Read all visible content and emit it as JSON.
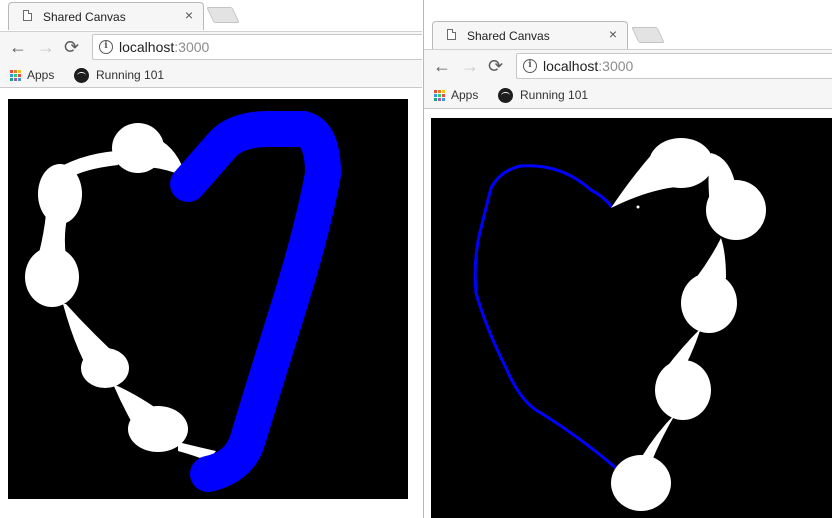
{
  "windows": [
    {
      "tab": {
        "title": "Shared Canvas",
        "close": "×"
      },
      "url": {
        "host": "localhost",
        "port": ":3000"
      },
      "bookmarks": {
        "apps": "Apps",
        "running": "Running 101"
      }
    },
    {
      "tab": {
        "title": "Shared Canvas",
        "close": "×"
      },
      "url": {
        "host": "localhost",
        "port": ":3000"
      },
      "bookmarks": {
        "apps": "Apps",
        "running": "Running 101"
      }
    }
  ],
  "colors": {
    "canvas_bg": "#000000",
    "stroke_white": "#ffffff",
    "stroke_blue": "#0000ff"
  },
  "icons": [
    "page-icon",
    "close-icon",
    "back-arrow-icon",
    "forward-arrow-icon",
    "reload-icon",
    "info-icon",
    "apps-grid-icon",
    "spotify-icon"
  ]
}
